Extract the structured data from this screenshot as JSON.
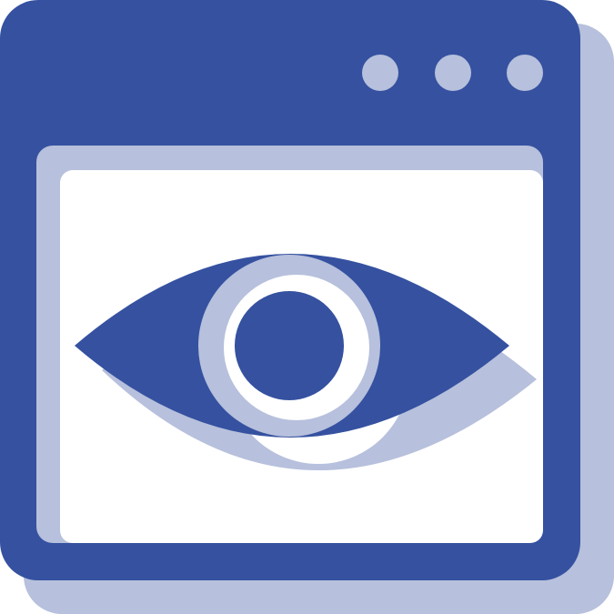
{
  "icon": {
    "name": "browser-window-eye-icon",
    "colors": {
      "primary": "#3551a0",
      "shadow": "#b7c0dc",
      "content_background": "#ffffff"
    },
    "window_control_dots": 3
  }
}
